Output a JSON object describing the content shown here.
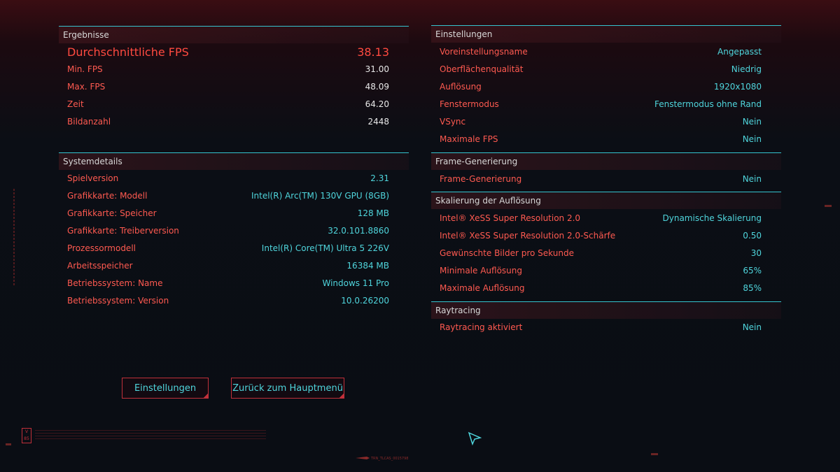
{
  "results": {
    "title": "Ergebnisse",
    "avg_label": "Durchschnittliche FPS",
    "avg_value": "38.13",
    "rows": [
      {
        "label": "Min. FPS",
        "value": "31.00"
      },
      {
        "label": "Max. FPS",
        "value": "48.09"
      },
      {
        "label": "Zeit",
        "value": "64.20"
      },
      {
        "label": "Bildanzahl",
        "value": "2448"
      }
    ]
  },
  "system": {
    "title": "Systemdetails",
    "rows": [
      {
        "label": "Spielversion",
        "value": "2.31"
      },
      {
        "label": "Grafikkarte: Modell",
        "value": "Intel(R) Arc(TM) 130V GPU (8GB)"
      },
      {
        "label": "Grafikkarte: Speicher",
        "value": "128 MB"
      },
      {
        "label": "Grafikkarte: Treiberversion",
        "value": "32.0.101.8860"
      },
      {
        "label": "Prozessormodell",
        "value": "Intel(R) Core(TM) Ultra 5 226V"
      },
      {
        "label": "Arbeitsspeicher",
        "value": "16384 MB"
      },
      {
        "label": "Betriebssystem: Name",
        "value": "Windows 11 Pro"
      },
      {
        "label": "Betriebssystem: Version",
        "value": "10.0.26200"
      }
    ]
  },
  "settings": {
    "title": "Einstellungen",
    "rows": [
      {
        "label": "Voreinstellungsname",
        "value": "Angepasst"
      },
      {
        "label": "Oberflächenqualität",
        "value": "Niedrig"
      },
      {
        "label": "Auflösung",
        "value": "1920x1080"
      },
      {
        "label": "Fenstermodus",
        "value": "Fenstermodus ohne Rand"
      },
      {
        "label": "VSync",
        "value": "Nein"
      },
      {
        "label": "Maximale FPS",
        "value": "Nein"
      }
    ]
  },
  "framegen": {
    "title": "Frame-Generierung",
    "rows": [
      {
        "label": "Frame-Generierung",
        "value": "Nein"
      }
    ]
  },
  "scaling": {
    "title": "Skalierung der Auflösung",
    "rows": [
      {
        "label": "Intel® XeSS Super Resolution 2.0",
        "value": "Dynamische Skalierung"
      },
      {
        "label": "Intel® XeSS Super Resolution 2.0-Schärfe",
        "value": "0.50"
      },
      {
        "label": "Gewünschte Bilder pro Sekunde",
        "value": "30"
      },
      {
        "label": "Minimale Auflösung",
        "value": "65%"
      },
      {
        "label": "Maximale Auflösung",
        "value": "85%"
      }
    ]
  },
  "raytracing": {
    "title": "Raytracing",
    "rows": [
      {
        "label": "Raytracing aktiviert",
        "value": "Nein"
      }
    ]
  },
  "buttons": {
    "settings": "Einstellungen",
    "back": "Zurück zum Hauptmenü"
  },
  "decor": {
    "logo": "V 85",
    "bottom_code": "TRN_TLCAS_0015798"
  },
  "colors": {
    "label": "#ff5a50",
    "value": "#4fd5dc",
    "divider": "#35c4cf",
    "header_text": "#d8d8d8"
  }
}
